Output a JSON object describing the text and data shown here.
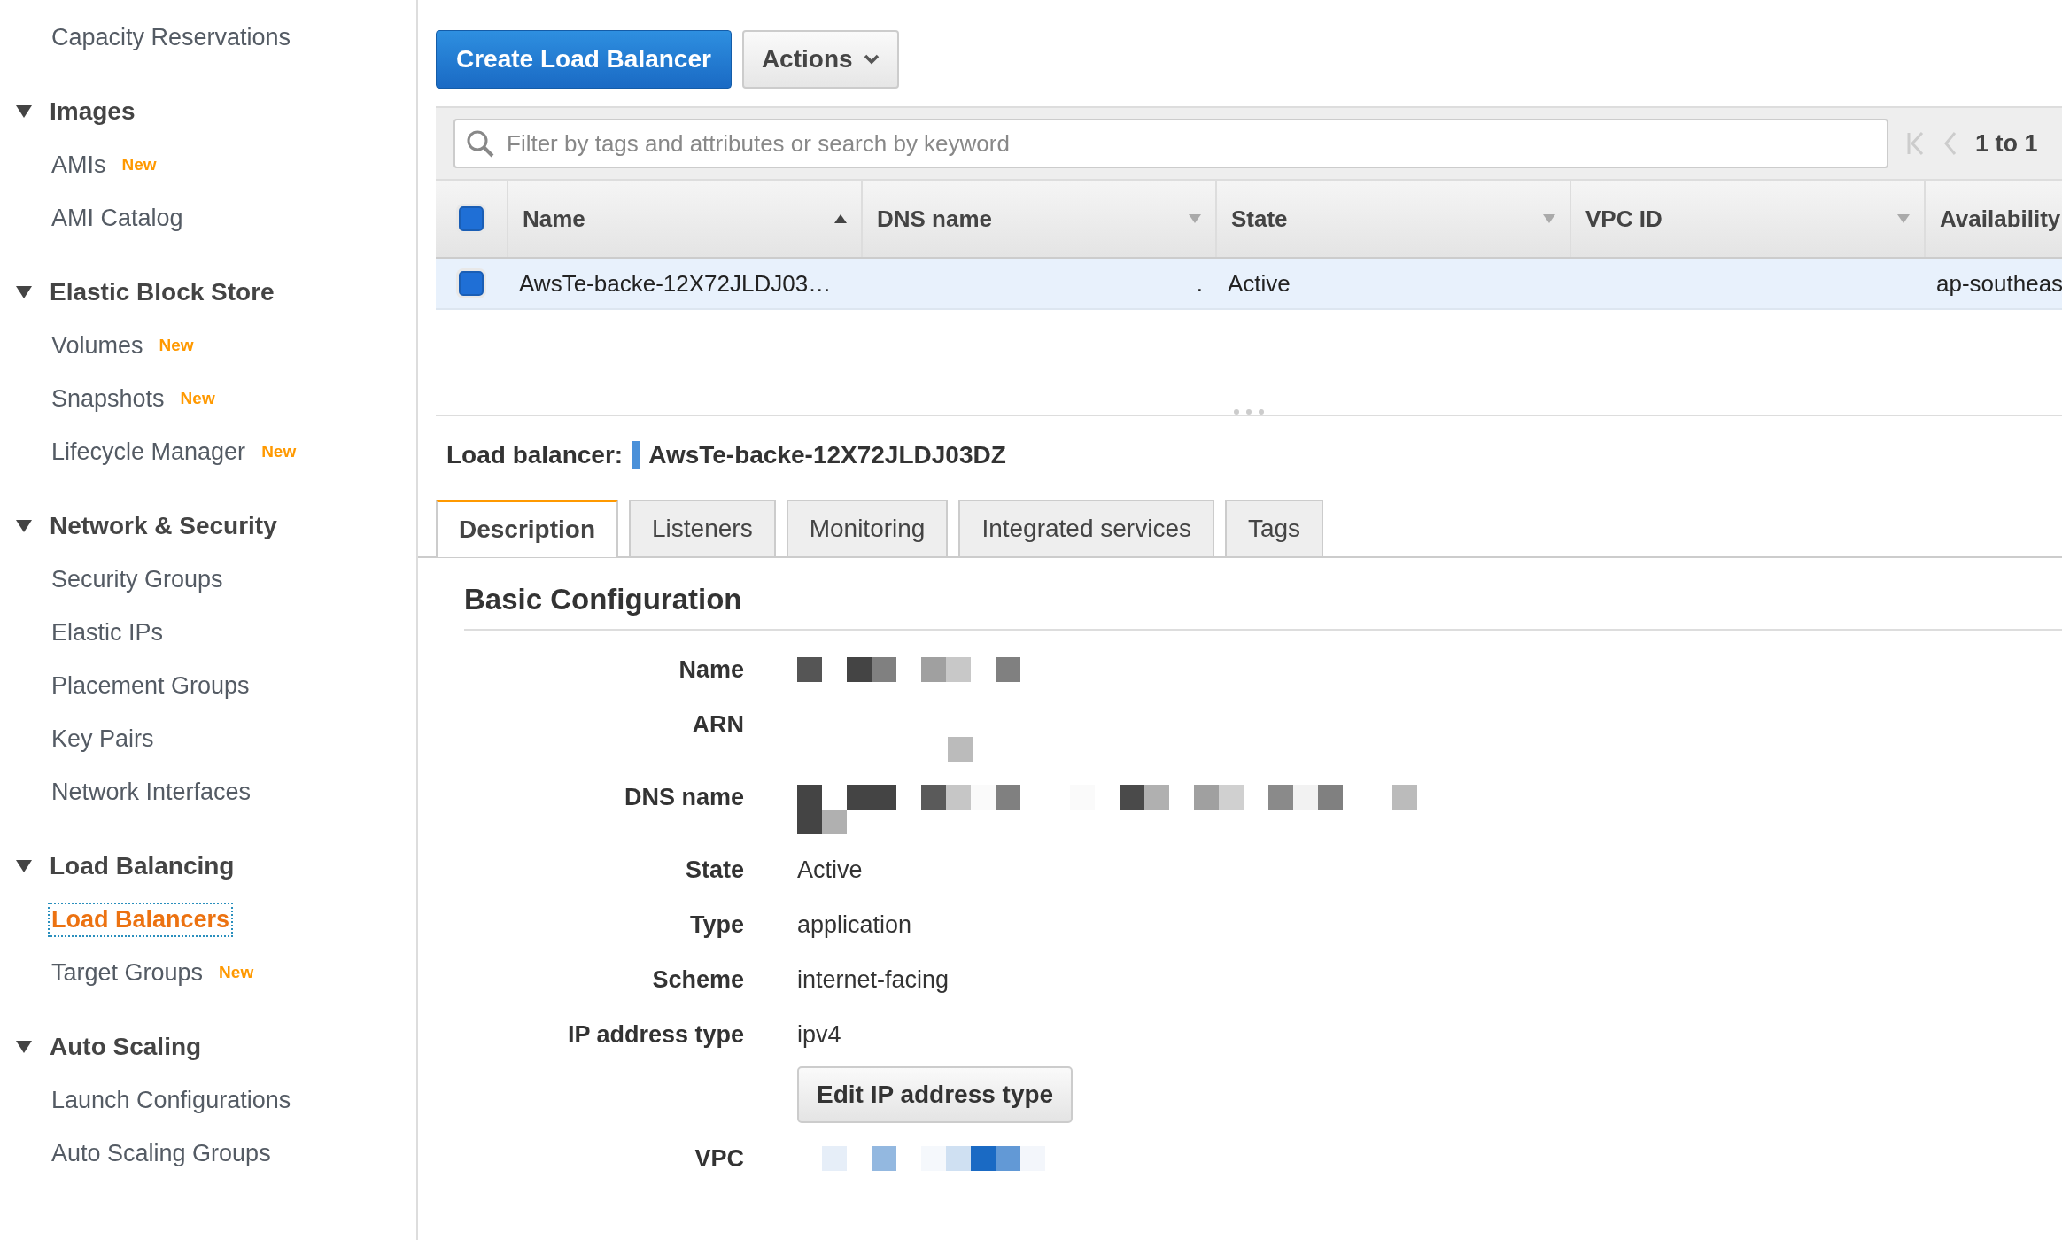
{
  "sidebar": {
    "groups": [
      {
        "items": [
          {
            "label": "Capacity Reservations",
            "selected": false
          }
        ]
      },
      {
        "title": "Images",
        "items": [
          {
            "label": "AMIs",
            "badge": "New",
            "selected": false
          },
          {
            "label": "AMI Catalog",
            "selected": false
          }
        ]
      },
      {
        "title": "Elastic Block Store",
        "items": [
          {
            "label": "Volumes",
            "badge": "New",
            "selected": false
          },
          {
            "label": "Snapshots",
            "badge": "New",
            "selected": false
          },
          {
            "label": "Lifecycle Manager",
            "badge": "New",
            "selected": false
          }
        ]
      },
      {
        "title": "Network & Security",
        "items": [
          {
            "label": "Security Groups",
            "selected": false
          },
          {
            "label": "Elastic IPs",
            "selected": false
          },
          {
            "label": "Placement Groups",
            "selected": false
          },
          {
            "label": "Key Pairs",
            "selected": false
          },
          {
            "label": "Network Interfaces",
            "selected": false
          }
        ]
      },
      {
        "title": "Load Balancing",
        "items": [
          {
            "label": "Load Balancers",
            "selected": true
          },
          {
            "label": "Target Groups",
            "badge": "New",
            "selected": false
          }
        ]
      },
      {
        "title": "Auto Scaling",
        "items": [
          {
            "label": "Launch Configurations",
            "selected": false
          },
          {
            "label": "Auto Scaling Groups",
            "selected": false
          }
        ]
      }
    ]
  },
  "toolbar": {
    "primary": "Create Load Balancer",
    "actions": "Actions"
  },
  "filter": {
    "placeholder": "Filter by tags and attributes or search by keyword",
    "pagination": "1 to 1"
  },
  "table": {
    "select_all_checked": true,
    "columns": [
      {
        "label": "Name",
        "sorted": true
      },
      {
        "label": "DNS name",
        "sorted": false
      },
      {
        "label": "State",
        "sorted": false
      },
      {
        "label": "VPC ID",
        "sorted": false
      },
      {
        "label": "Availability"
      }
    ],
    "rows": [
      {
        "selected": true,
        "checked": true,
        "cells": [
          "AwsTe-backe-12X72JLDJ03…",
          ".",
          "Active",
          null,
          "ap-southeas"
        ]
      }
    ]
  },
  "detail": {
    "label": "Load balancer:",
    "name": "AwsTe-backe-12X72JLDJ03DZ",
    "tabs": [
      {
        "label": "Description",
        "selected": true
      },
      {
        "label": "Listeners",
        "selected": false
      },
      {
        "label": "Monitoring",
        "selected": false
      },
      {
        "label": "Integrated services",
        "selected": false
      },
      {
        "label": "Tags",
        "selected": false
      }
    ],
    "section": "Basic Configuration",
    "fields": [
      {
        "label": "Name",
        "kind": "redacted"
      },
      {
        "label": "ARN",
        "kind": "redacted"
      },
      {
        "label": "DNS name",
        "kind": "redacted"
      },
      {
        "label": "State",
        "kind": "text",
        "value": "Active"
      },
      {
        "label": "Type",
        "kind": "text",
        "value": "application"
      },
      {
        "label": "Scheme",
        "kind": "text",
        "value": "internet-facing"
      },
      {
        "label": "IP address type",
        "kind": "text",
        "value": "ipv4",
        "action": "Edit IP address type"
      },
      {
        "label": "VPC",
        "kind": "redactedlink"
      }
    ]
  }
}
